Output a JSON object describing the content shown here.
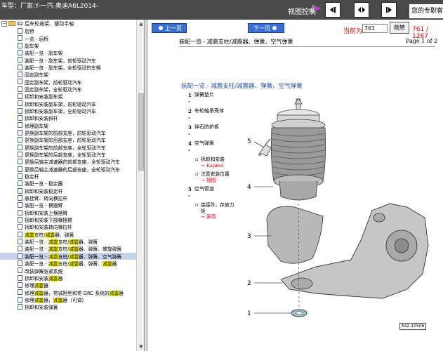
{
  "topbar": {
    "vehicle": "车型：厂家:Y-一汽-奥迪A6L2014-",
    "view_control": "视图控制",
    "promo": "您的专职客"
  },
  "tree": {
    "root_label": "42 后车轮悬架、摆动半轴",
    "items": [
      {
        "segs": [
          {
            "t": "后桥"
          }
        ]
      },
      {
        "segs": [
          {
            "t": "一览 - 后桥"
          }
        ]
      },
      {
        "segs": [
          {
            "t": "副车架"
          }
        ]
      },
      {
        "segs": [
          {
            "t": "装配一览 - 副车架"
          }
        ]
      },
      {
        "segs": [
          {
            "t": "装配一览 - 副车架，前轮驱动汽车"
          }
        ]
      },
      {
        "segs": [
          {
            "t": "装配一览 - 副车架，全轮驱动的车辆"
          }
        ]
      },
      {
        "segs": [
          {
            "t": "固定副车架"
          }
        ]
      },
      {
        "segs": [
          {
            "t": "固定副车架，前轮驱动汽车"
          }
        ]
      },
      {
        "segs": [
          {
            "t": "固定副车架，全轮驱动汽车"
          }
        ]
      },
      {
        "segs": [
          {
            "t": "拆卸和安装副车架"
          }
        ]
      },
      {
        "segs": [
          {
            "t": "拆卸和安装副车架，前轮驱动汽车"
          }
        ]
      },
      {
        "segs": [
          {
            "t": "拆卸和安装副车架，全轮驱动汽车"
          }
        ]
      },
      {
        "segs": [
          {
            "t": "拆卸和安装斜杆"
          }
        ]
      },
      {
        "segs": [
          {
            "t": "修理副车架"
          }
        ]
      },
      {
        "segs": [
          {
            "t": "更换副车架的前部支座，前轮驱动汽车"
          }
        ]
      },
      {
        "segs": [
          {
            "t": "更换副车架的后部支座，前轮驱动汽车"
          }
        ]
      },
      {
        "segs": [
          {
            "t": "更换副车架的前部支座，全轮驱动汽车"
          }
        ]
      },
      {
        "segs": [
          {
            "t": "更换副车架的后部支座，全轮驱动汽车"
          }
        ]
      },
      {
        "segs": [
          {
            "t": "更换后轴主减速器的前部支座，全轮驱动汽车"
          }
        ]
      },
      {
        "segs": [
          {
            "t": "更换后轴主减速器的后部支座，全轮驱动汽车"
          }
        ]
      },
      {
        "segs": [
          {
            "t": "稳定杆"
          }
        ]
      },
      {
        "segs": [
          {
            "t": "装配一览 - 稳定器"
          }
        ]
      },
      {
        "segs": [
          {
            "t": "拆卸和安装稳定杆"
          }
        ]
      },
      {
        "segs": [
          {
            "t": "悬挂臂、转向横拉杆"
          }
        ]
      },
      {
        "segs": [
          {
            "t": "装配一览 - 横摆臂"
          }
        ]
      },
      {
        "segs": [
          {
            "t": "拆卸和安装上横摆臂"
          }
        ]
      },
      {
        "segs": [
          {
            "t": "拆卸和安装下部横摆臂"
          }
        ]
      },
      {
        "segs": [
          {
            "t": "拆卸和安装转向横拉杆"
          }
        ]
      },
      {
        "segs": [
          {
            "t": "减震",
            "hl": true
          },
          {
            "t": "支柱/"
          },
          {
            "t": "减震",
            "hl": true
          },
          {
            "t": "器、弹簧"
          }
        ]
      },
      {
        "segs": [
          {
            "t": "装配一览 - "
          },
          {
            "t": "减震",
            "hl": true
          },
          {
            "t": "支柱/"
          },
          {
            "t": "减震",
            "hl": true
          },
          {
            "t": "器、弹簧"
          }
        ]
      },
      {
        "segs": [
          {
            "t": "装配一览 - "
          },
          {
            "t": "减震",
            "hl": true
          },
          {
            "t": "支柱/"
          },
          {
            "t": "减震",
            "hl": true
          },
          {
            "t": "器、弹簧、螺旋弹簧"
          }
        ]
      },
      {
        "segs": [
          {
            "t": "装配一览 - "
          },
          {
            "t": "减震",
            "hl": true
          },
          {
            "t": "支柱/"
          },
          {
            "t": "减震",
            "hl": true
          },
          {
            "t": "器、弹簧、空气弹簧"
          }
        ],
        "selected": true
      },
      {
        "segs": [
          {
            "t": "装配一览 - "
          },
          {
            "t": "减震",
            "hl": true
          },
          {
            "t": "支柱/"
          },
          {
            "t": "减震",
            "hl": true
          },
          {
            "t": "器、弹簧、"
          },
          {
            "t": "减震",
            "hl": true
          },
          {
            "t": "器"
          }
        ]
      },
      {
        "segs": [
          {
            "t": "改装弹簧张紧系统"
          }
        ]
      },
      {
        "segs": [
          {
            "t": "拆卸和安装"
          },
          {
            "t": "减震",
            "hl": true
          },
          {
            "t": "器"
          }
        ]
      },
      {
        "segs": [
          {
            "t": "修理"
          },
          {
            "t": "减震",
            "hl": true
          },
          {
            "t": "器"
          }
        ]
      },
      {
        "segs": [
          {
            "t": "修理"
          },
          {
            "t": "减震",
            "hl": true
          },
          {
            "t": "器，带减阻型和带 DRC 系统的"
          },
          {
            "t": "减震",
            "hl": true
          },
          {
            "t": "器"
          }
        ]
      },
      {
        "segs": [
          {
            "t": "修理"
          },
          {
            "t": "减震",
            "hl": true
          },
          {
            "t": "器，"
          },
          {
            "t": "减震",
            "hl": true
          },
          {
            "t": "器（可调）"
          }
        ]
      },
      {
        "segs": [
          {
            "t": "拆卸和安装弹簧"
          }
        ]
      }
    ]
  },
  "docnav": {
    "prev": "上一页",
    "next": "下一页",
    "current_label": "当前为",
    "page_value": "761",
    "jump": "跳转",
    "page_count": "761 / 1267"
  },
  "doc": {
    "header_title": "装配一览 - 减震支柱/减震器、弹簧、空气弹簧",
    "page_of": "Page 1 of 2",
    "section_title": "装配一览 - 减震支柱/减震器、弹簧、空气弹簧",
    "legend": [
      {
        "num": "1 -",
        "text": "弹簧垫片",
        "subs": []
      },
      {
        "num": "2 -",
        "text": "车轮轴承壳体",
        "subs": []
      },
      {
        "num": "3 -",
        "text": "碎石防护板",
        "subs": []
      },
      {
        "num": "4 -",
        "text": "空气弹簧",
        "subs": [
          {
            "text": "拆卸和安装",
            "link": "→ Kapitel"
          },
          {
            "text": "注意安装位置",
            "link": "→ 插图"
          }
        ]
      },
      {
        "num": "5 -",
        "text": "空气管道",
        "subs": [
          {
            "text": "连接件，存放力矩",
            "link": "→ 第项"
          }
        ]
      }
    ],
    "figure_labels": [
      "5",
      "4",
      "3",
      "2",
      "1"
    ],
    "figure_code": "A42-10506"
  }
}
